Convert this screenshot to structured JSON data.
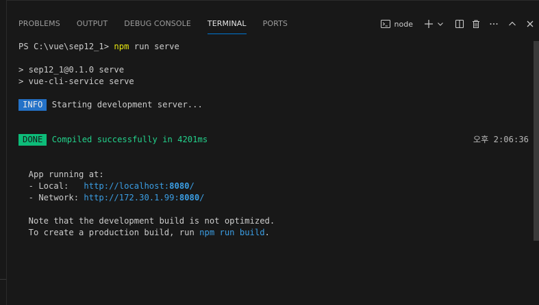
{
  "tabs": [
    {
      "label": "PROBLEMS",
      "active": false
    },
    {
      "label": "OUTPUT",
      "active": false
    },
    {
      "label": "DEBUG CONSOLE",
      "active": false
    },
    {
      "label": "TERMINAL",
      "active": true
    },
    {
      "label": "PORTS",
      "active": false
    }
  ],
  "toolbar": {
    "terminal_name": "node",
    "icons": [
      "terminal-icon",
      "plus-icon",
      "chevron-down-icon",
      "split-icon",
      "trash-icon",
      "more-icon",
      "chevron-up-icon",
      "close-icon"
    ]
  },
  "terminal": {
    "prompt": "PS C:\\vue\\sep12_1> ",
    "command": "npm",
    "command_args": " run serve",
    "out1": "> sep12_1@0.1.0 serve",
    "out2": "> vue-cli-service serve",
    "info_badge": "INFO",
    "info_text": " Starting development server...",
    "done_badge": "DONE",
    "done_text": " Compiled successfully in 4201ms",
    "timestamp": "오후 2:06:36",
    "app_running": "  App running at:",
    "local_label": "  - Local:   ",
    "local_url_host": "http://localhost:",
    "local_url_port": "8080",
    "local_url_tail": "/",
    "network_label": "  - Network: ",
    "network_url_host": "http://172.30.1.99:",
    "network_url_port": "8080",
    "network_url_tail": "/",
    "note1": "  Note that the development build is not optimized.",
    "note2_pre": "  To create a production build, run ",
    "note2_cmd": "npm run build",
    "note2_post": "."
  },
  "colors": {
    "background": "#181818",
    "accent": "#0078d4",
    "info": "#2472c8",
    "done": "#0dbc79",
    "link": "#3b9ee4",
    "command": "#e5e510"
  }
}
